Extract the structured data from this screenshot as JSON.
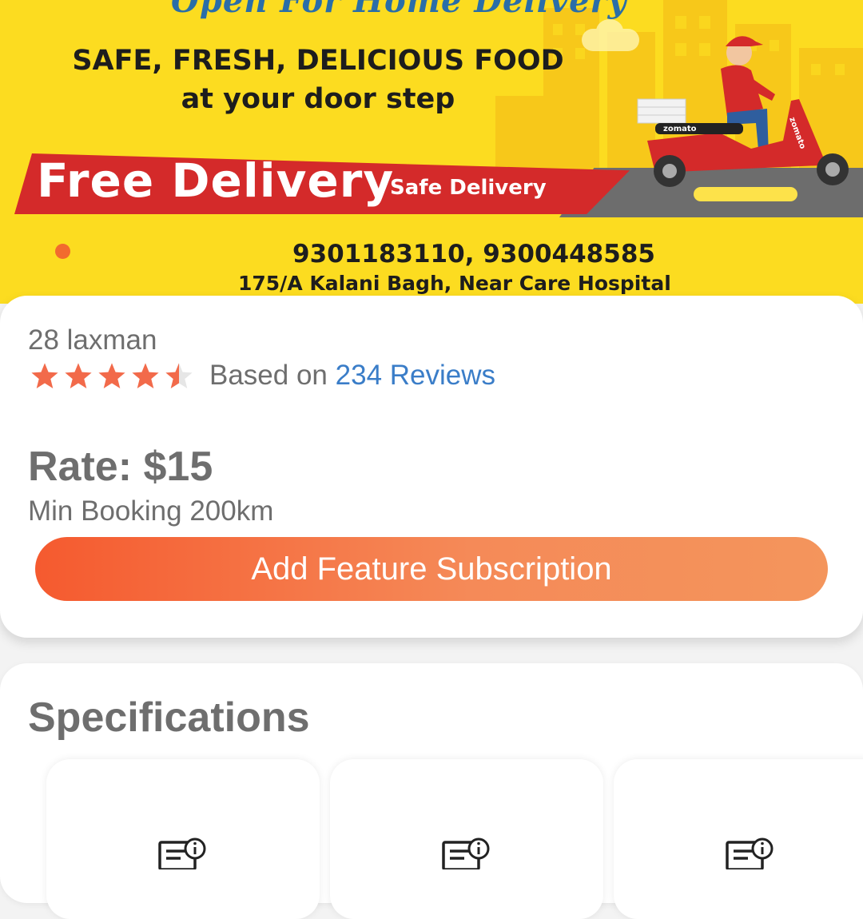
{
  "banner": {
    "headline_top": "Open For Home Delivery",
    "tagline_line1": "SAFE, FRESH, DELICIOUS FOOD",
    "tagline_line2": "at your door step",
    "ribbon_main": "Free Delivery",
    "ribbon_sub": "Safe Delivery",
    "phones": "9301183110, 9300448585",
    "address": "175/A Kalani Bagh, Near Care Hospital",
    "scooter_brand": "zomato",
    "carousel_active_index": 0,
    "colors": {
      "background": "#fcdc20",
      "ribbon": "#d42a2a",
      "dot": "#f26a2e"
    }
  },
  "listing": {
    "name": "28 laxman",
    "rating": 4.5,
    "rating_max": 5,
    "based_on_prefix": "Based on",
    "reviews_link": "234 Reviews",
    "rate": "Rate: $15",
    "min_booking": "Min Booking 200km",
    "cta_label": "Add Feature Subscription"
  },
  "specifications": {
    "title": "Specifications",
    "tiles": [
      {
        "icon": "certificate-info-icon"
      },
      {
        "icon": "certificate-info-icon"
      },
      {
        "icon": "certificate-info-icon"
      }
    ]
  },
  "colors": {
    "accent": "#f55a2f",
    "link": "#3a7dc8",
    "star": "#f26a4a",
    "text_muted": "#6e6e6e"
  }
}
